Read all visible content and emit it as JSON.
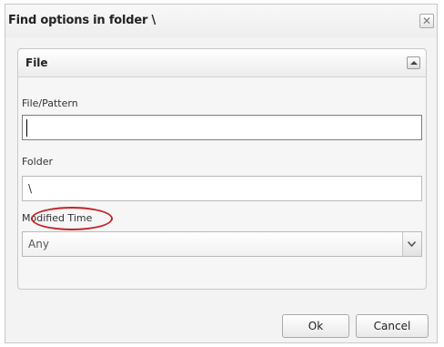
{
  "dialog": {
    "title": "Find options in folder \\",
    "close_glyph": "✕"
  },
  "panel": {
    "title": "File"
  },
  "fields": {
    "file_pattern_label": "File/Pattern",
    "file_pattern_value": "",
    "folder_label": "Folder",
    "folder_value": "\\",
    "modified_time_label": "Modified Time",
    "modified_time_value": "Any"
  },
  "buttons": {
    "ok": "Ok",
    "cancel": "Cancel"
  },
  "colors": {
    "annotation_circle": "#c0262a"
  },
  "icons": {
    "close": "close-icon",
    "collapse": "chevron-up-icon",
    "dropdown": "chevron-down-icon"
  }
}
